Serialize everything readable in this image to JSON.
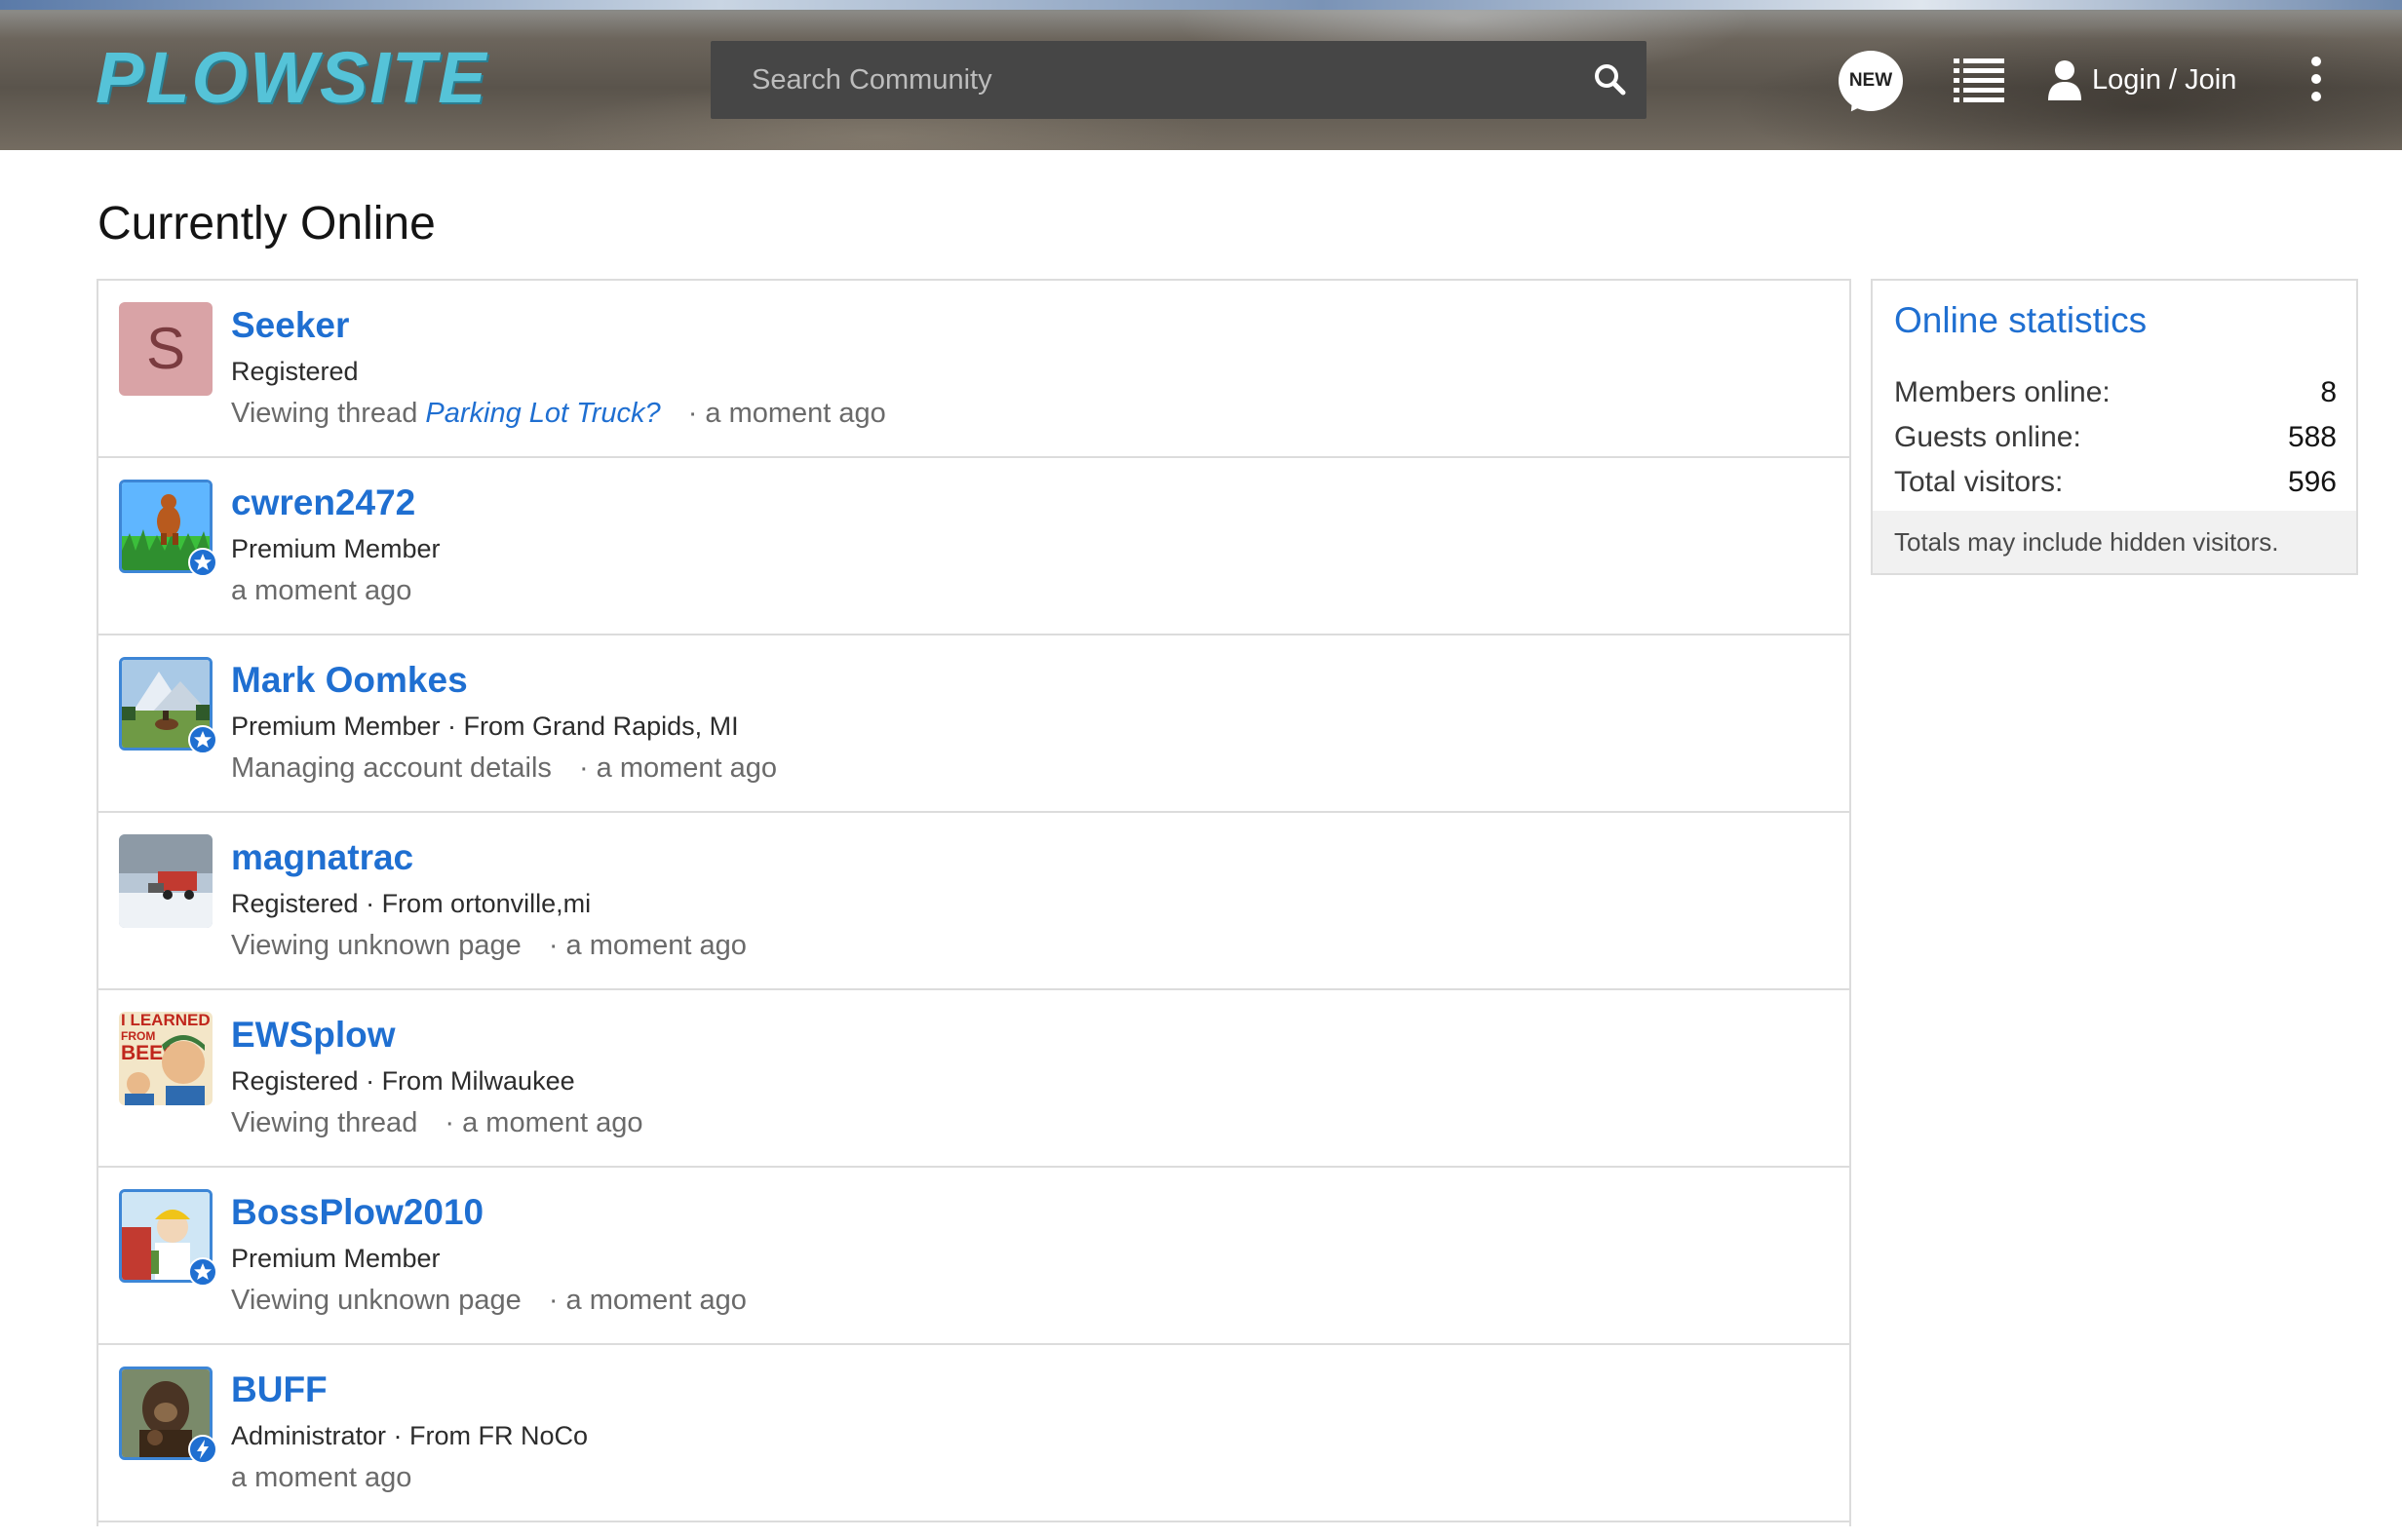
{
  "header": {
    "logo_text": "PLOWSITE",
    "search_placeholder": "Search Community",
    "new_label": "NEW",
    "login_label": "Login / Join"
  },
  "page": {
    "title": "Currently Online"
  },
  "users": [
    {
      "name": "Seeker",
      "meta": "Registered",
      "activity": "Viewing thread",
      "thread": "Parking Lot Truck?",
      "time": "· a moment ago",
      "avatar_letter": "S"
    },
    {
      "name": "cwren2472",
      "meta": "Premium Member",
      "activity": "",
      "thread": "",
      "time": "a moment ago"
    },
    {
      "name": "Mark Oomkes",
      "meta": "Premium Member · From Grand Rapids, MI",
      "activity": "Managing account details",
      "thread": "",
      "time": "· a moment ago"
    },
    {
      "name": "magnatrac",
      "meta": "Registered · From ortonville,mi",
      "activity": "Viewing unknown page",
      "thread": "",
      "time": "· a moment ago"
    },
    {
      "name": "EWSplow",
      "meta": "Registered · From Milwaukee",
      "activity": "Viewing thread",
      "thread": "",
      "time": "· a moment ago",
      "avatar_text_1": "I LEARNED",
      "avatar_text_2": "FROM",
      "avatar_text_3": "BEER"
    },
    {
      "name": "BossPlow2010",
      "meta": "Premium Member",
      "activity": "Viewing unknown page",
      "thread": "",
      "time": "· a moment ago"
    },
    {
      "name": "BUFF",
      "meta": "Administrator · From FR NoCo",
      "activity": "",
      "thread": "",
      "time": "a moment ago"
    }
  ],
  "stats": {
    "title": "Online statistics",
    "rows": [
      {
        "label": "Members online:",
        "value": "8"
      },
      {
        "label": "Guests online:",
        "value": "588"
      },
      {
        "label": "Total visitors:",
        "value": "596"
      }
    ],
    "note": "Totals may include hidden visitors."
  },
  "colors": {
    "accent": "#1f6fd1",
    "logo": "#55c3d8",
    "search_bg": "#464646",
    "divider": "#dcdcdc"
  },
  "icons": {
    "search": "search-icon",
    "new": "new-posts-icon",
    "list": "list-icon",
    "user": "user-icon",
    "menu": "kebab-menu-icon",
    "premium": "premium-star-badge-icon",
    "admin": "admin-bolt-badge-icon"
  }
}
